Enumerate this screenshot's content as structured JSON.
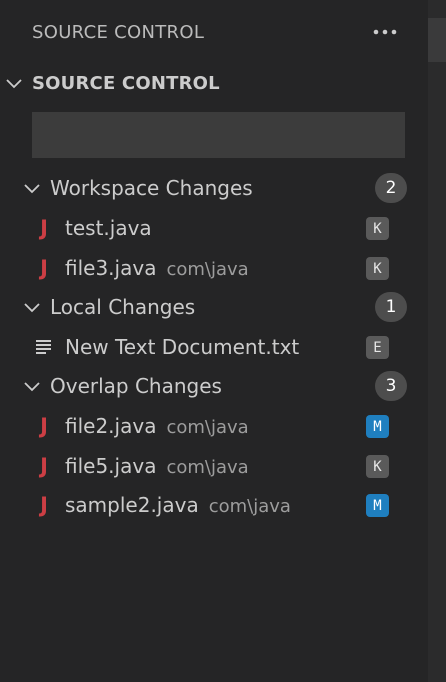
{
  "header": {
    "title": "SOURCE CONTROL",
    "more_icon": "ellipsis-icon"
  },
  "section": {
    "title": "SOURCE CONTROL",
    "commit_placeholder": ""
  },
  "groups": [
    {
      "label": "Workspace Changes",
      "count": "2",
      "files": [
        {
          "name": "test.java",
          "path": "",
          "icon": "java-file-icon",
          "status": "K"
        },
        {
          "name": "file3.java",
          "path": "com\\java",
          "icon": "java-file-icon",
          "status": "K"
        }
      ]
    },
    {
      "label": "Local Changes",
      "count": "1",
      "files": [
        {
          "name": "New Text Document.txt",
          "path": "",
          "icon": "text-file-icon",
          "status": "E"
        }
      ]
    },
    {
      "label": "Overlap Changes",
      "count": "3",
      "files": [
        {
          "name": "file2.java",
          "path": "com\\java",
          "icon": "java-file-icon",
          "status": "M"
        },
        {
          "name": "file5.java",
          "path": "com\\java",
          "icon": "java-file-icon",
          "status": "K"
        },
        {
          "name": "sample2.java",
          "path": "com\\java",
          "icon": "java-file-icon",
          "status": "M"
        }
      ]
    }
  ],
  "colors": {
    "background": "#252526",
    "java_icon": "#cc3e44",
    "status_gray": "#5a5a5a",
    "status_blue": "#1f7fbf",
    "badge": "#4d4d4d"
  }
}
